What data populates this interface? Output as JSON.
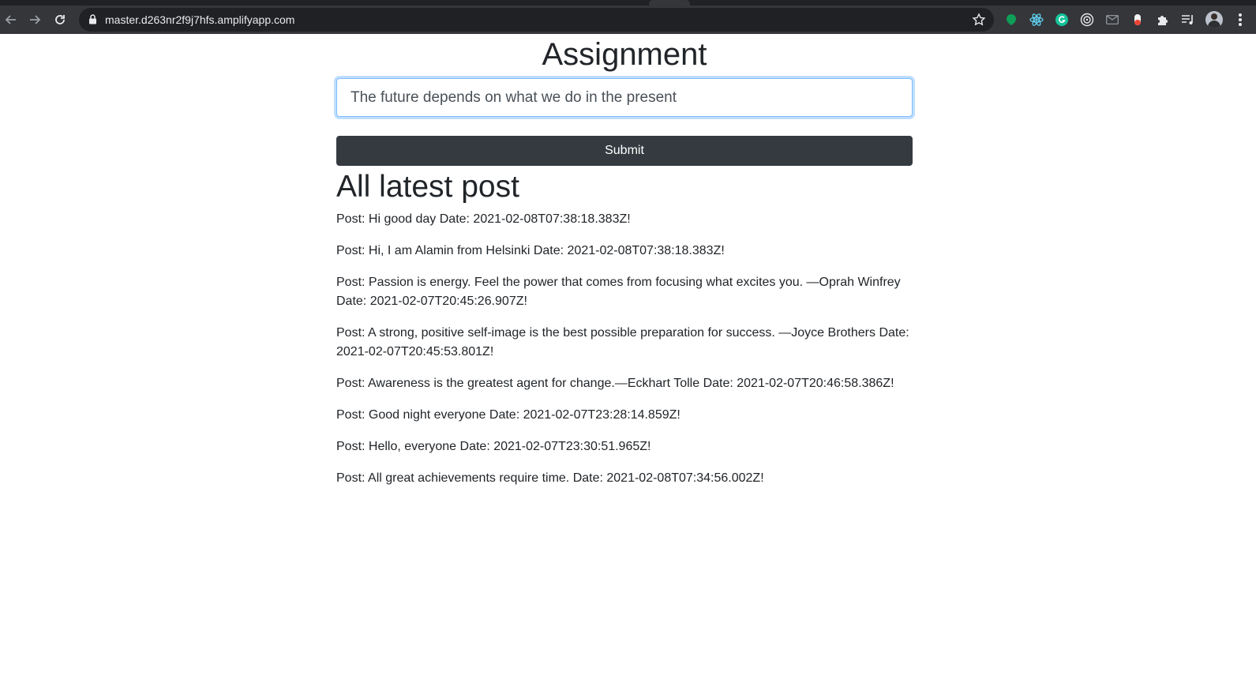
{
  "browser": {
    "url": "master.d263nr2f9j7hfs.amplifyapp.com",
    "extension_icons": [
      "green-dot-icon",
      "react-icon",
      "grammarly-icon",
      "target-icon",
      "mail-icon",
      "toggle-icon",
      "puzzle-icon",
      "reading-list-icon"
    ]
  },
  "page": {
    "title": "Assignment",
    "input_value": "The future depends on what we do in the present",
    "submit_label": "Submit",
    "list_title": "All latest post",
    "posts": [
      "Post: Hi good day Date: 2021-02-08T07:38:18.383Z!",
      "Post: Hi, I am Alamin from Helsinki Date: 2021-02-08T07:38:18.383Z!",
      "Post: Passion is energy. Feel the power that comes from focusing what excites you. —Oprah Winfrey Date: 2021-02-07T20:45:26.907Z!",
      "Post: A strong, positive self-image is the best possible preparation for success. —Joyce Brothers Date: 2021-02-07T20:45:53.801Z!",
      "Post: Awareness is the greatest agent for change.—Eckhart Tolle Date: 2021-02-07T20:46:58.386Z!",
      "Post: Good night everyone Date: 2021-02-07T23:28:14.859Z!",
      "Post: Hello, everyone Date: 2021-02-07T23:30:51.965Z!",
      "Post: All great achievements require time. Date: 2021-02-08T07:34:56.002Z!"
    ]
  },
  "colors": {
    "chrome_bg": "#35363a",
    "omnibox_bg": "#202124",
    "button_dark": "#343a40",
    "focus_border": "#80bdff",
    "text": "#212529"
  }
}
